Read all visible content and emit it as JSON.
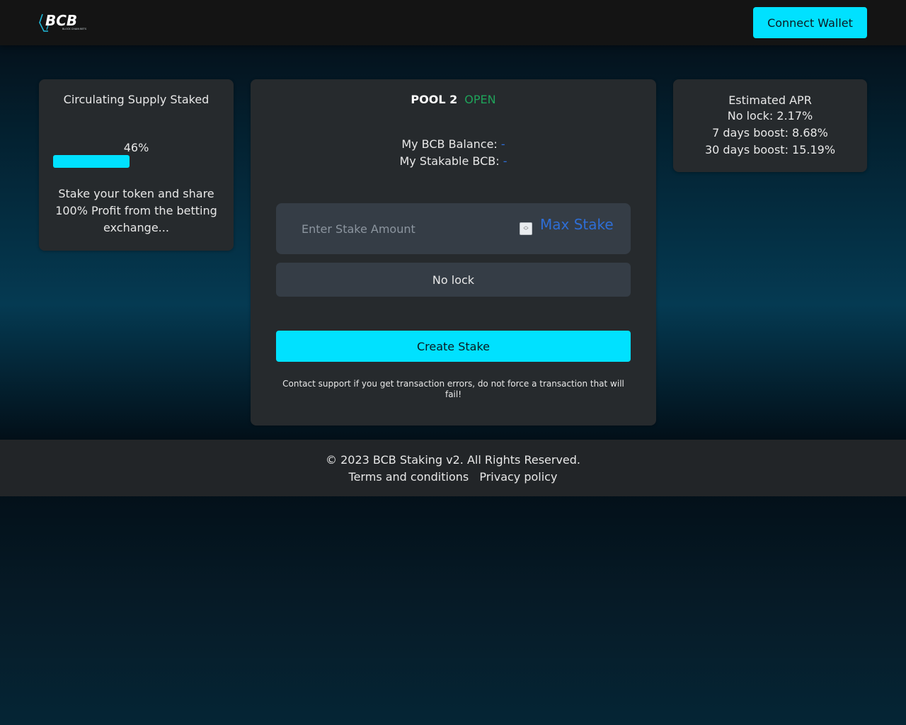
{
  "header": {
    "logo_text": "BCB",
    "logo_subtext": "BLOCK CHAIN BETS",
    "connect_label": "Connect Wallet"
  },
  "supply": {
    "title": "Circulating Supply Staked",
    "percent_label": "46%",
    "percent_value": 46,
    "description": "Stake your token and share 100% Profit from the betting exchange..."
  },
  "pool": {
    "name": "POOL 2",
    "status": "OPEN",
    "balance_label": "My BCB Balance:",
    "balance_value": "-",
    "stakable_label": "My Stakable BCB:",
    "stakable_value": "-",
    "stake_placeholder": "Enter Stake Amount",
    "max_label": "Max Stake",
    "lock_value": "No lock",
    "create_label": "Create Stake",
    "notice": "Contact support if you get transaction errors, do not force a transaction that will fail!"
  },
  "apr": {
    "title": "Estimated APR",
    "no_lock": "No lock: 2.17%",
    "seven_days": "7 days boost: 8.68%",
    "thirty_days": "30 days boost: 15.19%"
  },
  "footer": {
    "copyright": "© 2023 BCB Staking v2. All Rights Reserved.",
    "terms": "Terms and conditions",
    "privacy": "Privacy policy"
  },
  "colors": {
    "accent": "#00e1ff",
    "link": "#2e6ed6",
    "status_open": "#1fa35a",
    "card": "#262a2d"
  }
}
